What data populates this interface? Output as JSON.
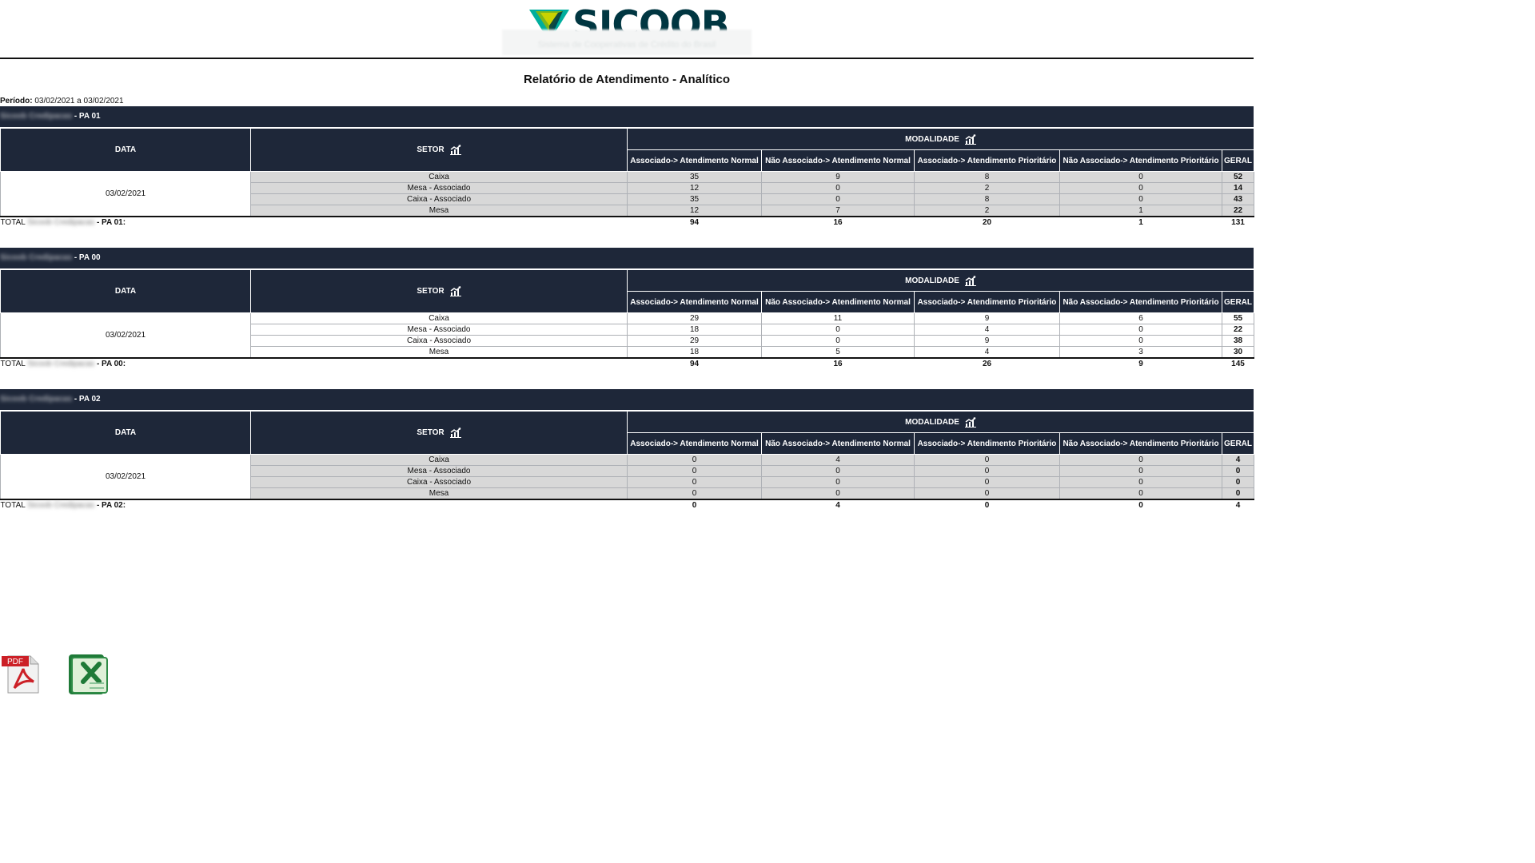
{
  "brand": {
    "name": "SICOOB",
    "subtitle_blurred": "Sistema de Cooperativas de Crédito do Brasil",
    "colors": {
      "dark_teal": "#003641",
      "green_light": "#c9d200",
      "green": "#7db61c",
      "teal": "#00ae9d",
      "header_bg": "#1e2739"
    }
  },
  "report": {
    "title": "Relatório de Atendimento - Analítico",
    "period_label": "Período:",
    "period_value": "03/02/2021 a 03/02/2021"
  },
  "columns": {
    "data": "DATA",
    "setor": "SETOR",
    "modalidade": "MODALIDADE",
    "assoc_normal": "Associado-> Atendimento Normal",
    "nao_assoc_normal": "Não Associado-> Atendimento Normal",
    "assoc_prior": "Associado-> Atendimento Prioritário",
    "nao_assoc_prior": "Não Associado-> Atendimento Prioritário",
    "geral": "GERAL"
  },
  "sections": [
    {
      "blurred_name": "Sicoob Credipacas",
      "pa_label": "- PA 01",
      "date": "03/02/2021",
      "rows": [
        {
          "setor": "Caixa",
          "v": [
            "35",
            "9",
            "8",
            "0"
          ],
          "geral": "52"
        },
        {
          "setor": "Mesa - Associado",
          "v": [
            "12",
            "0",
            "2",
            "0"
          ],
          "geral": "14"
        },
        {
          "setor": "Caixa - Associado",
          "v": [
            "35",
            "0",
            "8",
            "0"
          ],
          "geral": "43"
        },
        {
          "setor": "Mesa",
          "v": [
            "12",
            "7",
            "2",
            "1"
          ],
          "geral": "22"
        }
      ],
      "total_label": "TOTAL",
      "total_suffix": "- PA 01:",
      "totals": [
        "94",
        "16",
        "20",
        "1"
      ],
      "total_geral": "131"
    },
    {
      "blurred_name": "Sicoob Credipacas",
      "pa_label": "- PA 00",
      "date": "03/02/2021",
      "rows": [
        {
          "setor": "Caixa",
          "v": [
            "29",
            "11",
            "9",
            "6"
          ],
          "geral": "55"
        },
        {
          "setor": "Mesa - Associado",
          "v": [
            "18",
            "0",
            "4",
            "0"
          ],
          "geral": "22"
        },
        {
          "setor": "Caixa - Associado",
          "v": [
            "29",
            "0",
            "9",
            "0"
          ],
          "geral": "38"
        },
        {
          "setor": "Mesa",
          "v": [
            "18",
            "5",
            "4",
            "3"
          ],
          "geral": "30"
        }
      ],
      "total_label": "TOTAL",
      "total_suffix": "- PA 00:",
      "totals": [
        "94",
        "16",
        "26",
        "9"
      ],
      "total_geral": "145"
    },
    {
      "blurred_name": "Sicoob Credipacas",
      "pa_label": "- PA 02",
      "date": "03/02/2021",
      "rows": [
        {
          "setor": "Caixa",
          "v": [
            "0",
            "4",
            "0",
            "0"
          ],
          "geral": "4"
        },
        {
          "setor": "Mesa - Associado",
          "v": [
            "0",
            "0",
            "0",
            "0"
          ],
          "geral": "0"
        },
        {
          "setor": "Caixa - Associado",
          "v": [
            "0",
            "0",
            "0",
            "0"
          ],
          "geral": "0"
        },
        {
          "setor": "Mesa",
          "v": [
            "0",
            "0",
            "0",
            "0"
          ],
          "geral": "0"
        }
      ],
      "total_label": "TOTAL",
      "total_suffix": "- PA 02:",
      "totals": [
        "0",
        "4",
        "0",
        "0"
      ],
      "total_geral": "4"
    }
  ],
  "export": {
    "pdf_label": "PDF",
    "icons": [
      "pdf-icon",
      "excel-icon"
    ]
  }
}
